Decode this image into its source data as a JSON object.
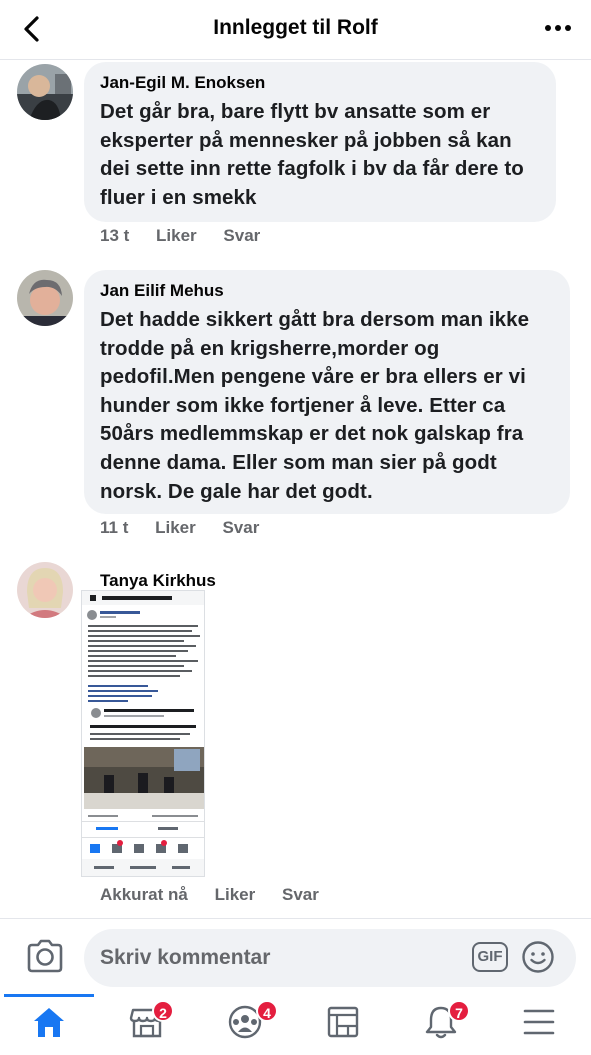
{
  "header": {
    "title": "Innlegget til Rolf"
  },
  "comments": [
    {
      "author": "Jan-Egil M. Enoksen",
      "text": "Det går bra, bare flytt bv ansatte som er eksperter på mennesker på jobben så kan dei sette inn rette fagfolk i bv da får dere to fluer i en smekk",
      "time": "13 t",
      "like": "Liker",
      "reply": "Svar"
    },
    {
      "author": "Jan Eilif Mehus",
      "text": "Det hadde sikkert gått bra dersom man ikke trodde på en krigsherre,morder og pedofil.Men pengene våre er bra ellers er vi hunder som ikke fortjener å leve. Etter ca 50års medlemmskap er det nok galskap fra denne dama. Eller som man sier på godt norsk. De gale  har det godt.",
      "time": "11 t",
      "like": "Liker",
      "reply": "Svar"
    },
    {
      "author": "Tanya Kirkhus",
      "time": "Akkurat nå",
      "like": "Liker",
      "reply": "Svar"
    }
  ],
  "composer": {
    "placeholder": "Skriv kommentar",
    "gif_label": "GIF"
  },
  "tabbar": {
    "tabs": [
      {
        "name": "home",
        "badge": ""
      },
      {
        "name": "marketplace",
        "badge": "2"
      },
      {
        "name": "groups",
        "badge": "4"
      },
      {
        "name": "pages",
        "badge": ""
      },
      {
        "name": "notifications",
        "badge": "7"
      },
      {
        "name": "menu",
        "badge": ""
      }
    ],
    "active_color": "#1877f2",
    "badge_color": "#e41e3f"
  }
}
